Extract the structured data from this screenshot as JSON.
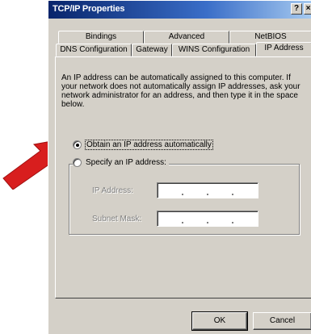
{
  "window": {
    "title": "TCP/IP Properties",
    "help_label": "?",
    "close_label": "×"
  },
  "tabs": {
    "back_row": [
      "Bindings",
      "Advanced",
      "NetBIOS"
    ],
    "front_row": [
      "DNS Configuration",
      "Gateway",
      "WINS Configuration",
      "IP Address"
    ],
    "active": "IP Address"
  },
  "panel": {
    "description": "An IP address can be automatically assigned to this computer. If your network does not automatically assign IP addresses, ask your network administrator for an address, and then type it in the space below.",
    "obtain_auto_label": "Obtain an IP address automatically",
    "specify_label": "Specify an IP address:",
    "ip_address_label": "IP Address:",
    "subnet_mask_label": "Subnet Mask:",
    "selected_option": "obtain_auto"
  },
  "buttons": {
    "ok_label": "OK",
    "cancel_label": "Cancel"
  },
  "colors": {
    "dialog_bg": "#d4d0c8",
    "titlebar_start": "#08246b",
    "titlebar_end": "#a6caf0",
    "arrow": "#d81e1e"
  },
  "icons": [
    "red-arrow-icon"
  ]
}
